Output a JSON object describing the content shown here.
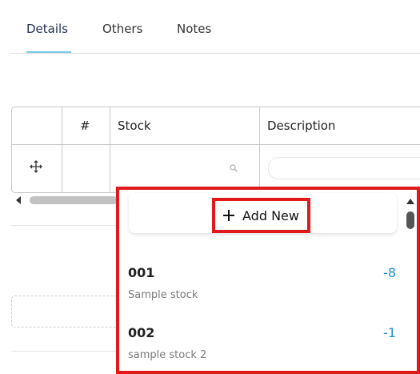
{
  "tabs": [
    {
      "label": "Details",
      "active": true
    },
    {
      "label": "Others",
      "active": false
    },
    {
      "label": "Notes",
      "active": false
    }
  ],
  "grid": {
    "columns": [
      "",
      "#",
      "Stock",
      "Description"
    ]
  },
  "dropdown": {
    "add_new_label": "Add New",
    "items": [
      {
        "code": "001",
        "description": "Sample stock",
        "quantity": "-8"
      },
      {
        "code": "002",
        "description": "sample stock 2",
        "quantity": "-1"
      }
    ]
  },
  "colors": {
    "highlight_border": "#e01a1a",
    "quantity": "#1e8fd6",
    "active_tab_underline": "#7fc6ea"
  }
}
